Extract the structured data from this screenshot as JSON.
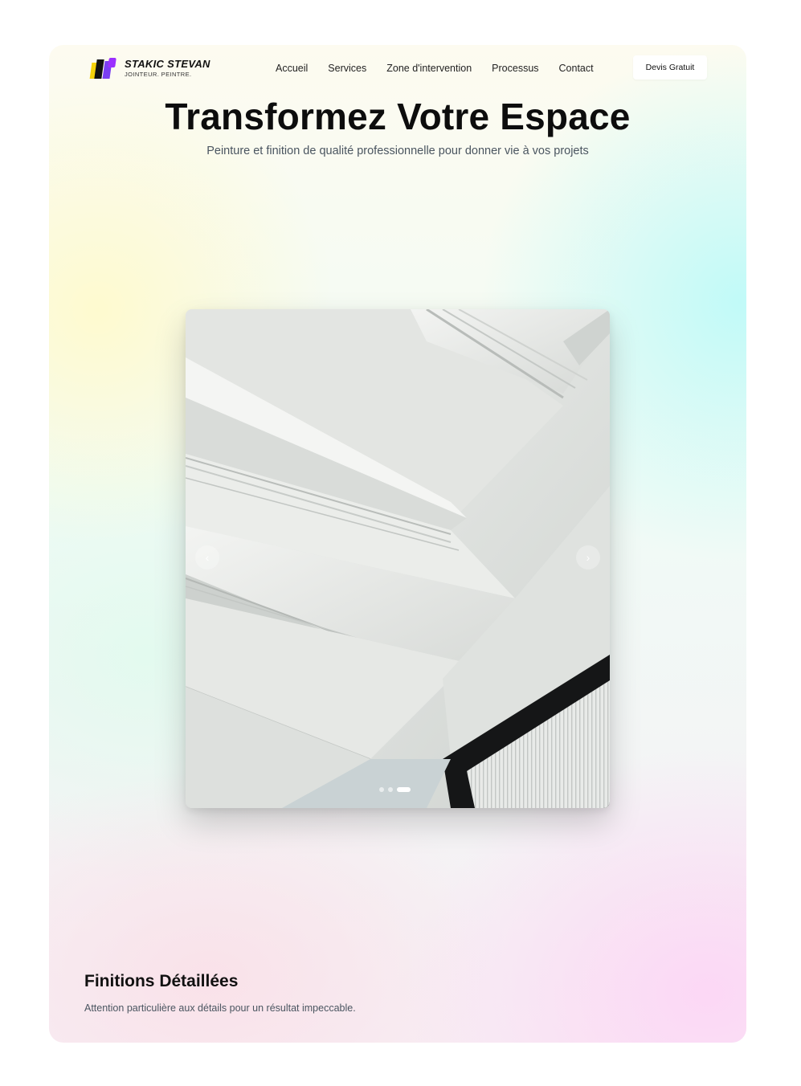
{
  "brand": {
    "name": "STAKIC STEVAN",
    "tagline": "JOINTEUR. PEINTRE."
  },
  "nav": {
    "items": [
      {
        "label": "Accueil"
      },
      {
        "label": "Services"
      },
      {
        "label": "Zone d'intervention"
      },
      {
        "label": "Processus"
      },
      {
        "label": "Contact"
      }
    ],
    "cta_label": "Devis Gratuit"
  },
  "hero": {
    "title": "Transformez Votre Espace",
    "subtitle": "Peinture et finition de qualité professionnelle pour donner vie à vos projets"
  },
  "slider": {
    "prev_icon": "chevron-left-icon",
    "next_icon": "chevron-right-icon",
    "slide_count": 3,
    "active_index": 2
  },
  "feature": {
    "title": "Finitions Détaillées",
    "description": "Attention particulière aux détails pour un résultat impeccable."
  },
  "colors": {
    "accent_purple": "#7a3ff2",
    "accent_yellow": "#f5d20a",
    "text_dark": "#111111",
    "text_muted": "#4a5560"
  }
}
